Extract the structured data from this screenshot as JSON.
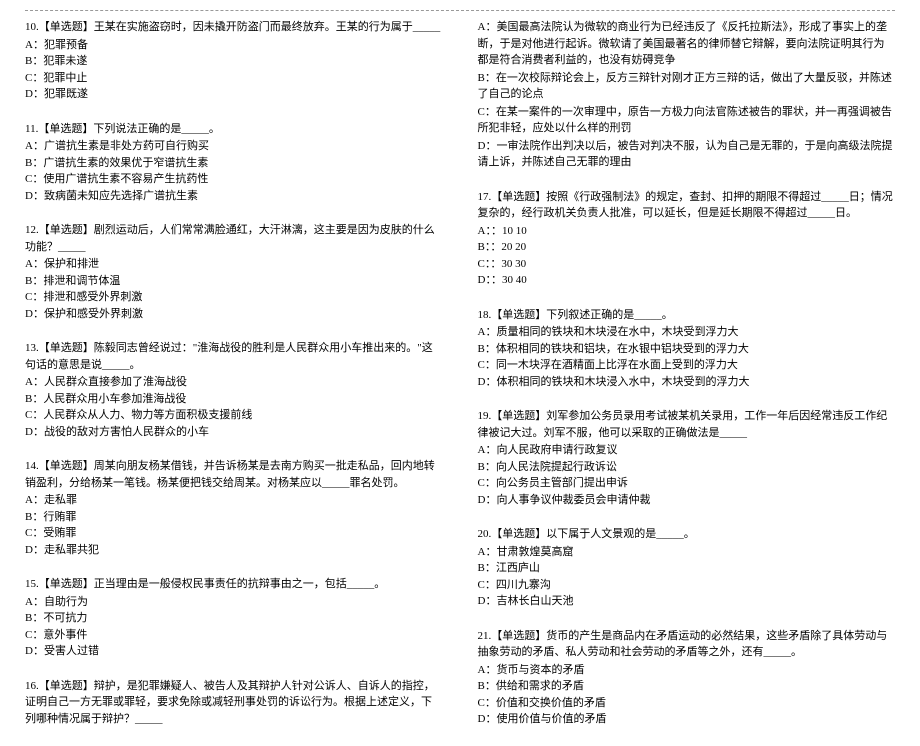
{
  "left": {
    "q10": {
      "title": "10.【单选题】王某在实施盗窃时，因未撬开防盗门而最终放弃。王某的行为属于_____",
      "a": "A：犯罪预备",
      "b": "B：犯罪未遂",
      "c": "C：犯罪中止",
      "d": "D：犯罪既遂"
    },
    "q11": {
      "title": "11.【单选题】下列说法正确的是_____。",
      "a": "A：广谱抗生素是非处方药可自行购买",
      "b": "B：广谱抗生素的效果优于窄谱抗生素",
      "c": "C：使用广谱抗生素不容易产生抗药性",
      "d": "D：致病菌未知应先选择广谱抗生素"
    },
    "q12": {
      "title": "12.【单选题】剧烈运动后，人们常常满脸通红，大汗淋漓，这主要是因为皮肤的什么功能？_____",
      "a": "A：保护和排泄",
      "b": "B：排泄和调节体温",
      "c": "C：排泄和感受外界刺激",
      "d": "D：保护和感受外界刺激"
    },
    "q13": {
      "title": "13.【单选题】陈毅同志曾经说过：\"淮海战役的胜利是人民群众用小车推出来的。\"这句话的意思是说_____。",
      "a": "A：人民群众直接参加了淮海战役",
      "b": "B：人民群众用小车参加淮海战役",
      "c": "C：人民群众从人力、物力等方面积极支援前线",
      "d": "D：战役的敌对方害怕人民群众的小车"
    },
    "q14": {
      "title": "14.【单选题】周某向朋友杨某借钱，并告诉杨某是去南方购买一批走私品，回内地转销盈利，分给杨某一笔钱。杨某便把钱交给周某。对杨某应以_____罪名处罚。",
      "a": "A：走私罪",
      "b": "B：行贿罪",
      "c": "C：受贿罪",
      "d": "D：走私罪共犯"
    },
    "q15": {
      "title": "15.【单选题】正当理由是一般侵权民事责任的抗辩事由之一，包括_____。",
      "a": "A：自助行为",
      "b": "B：不可抗力",
      "c": "C：意外事件",
      "d": "D：受害人过错"
    },
    "q16": {
      "title": "16.【单选题】辩护，是犯罪嫌疑人、被告人及其辩护人针对公诉人、自诉人的指控，证明自己一方无罪或罪轻，要求免除或减轻刑事处罚的诉讼行为。根据上述定义，下列哪种情况属于辩护？_____"
    }
  },
  "right": {
    "continuation": {
      "a": "A：美国最高法院认为微软的商业行为已经违反了《反托拉斯法》，形成了事实上的垄断，于是对他进行起诉。微软请了美国最著名的律师替它辩解，要向法院证明其行为都是符合消费者利益的，也没有妨碍竞争",
      "b": "B：在一次校际辩论会上，反方三辩针对刚才正方三辩的话，做出了大量反驳，并陈述了自己的论点",
      "c": "C：在某一案件的一次审理中，原告一方极力向法官陈述被告的罪状，并一再强调被告所犯非轻，应处以什么样的刑罚",
      "d": "D：一审法院作出判决以后，被告对判决不服，认为自己是无罪的，于是向高级法院提请上诉，并陈述自己无罪的理由"
    },
    "q17": {
      "title": "17.【单选题】按照《行政强制法》的规定，查封、扣押的期限不得超过_____日；情况复杂的，经行政机关负责人批准，可以延长，但是延长期限不得超过_____日。",
      "a": "A：：10 10",
      "b": "B：：20 20",
      "c": "C：：30 30",
      "d": "D：：30 40"
    },
    "q18": {
      "title": "18.【单选题】下列叙述正确的是_____。",
      "a": "A：质量相同的铁块和木块浸在水中，木块受到浮力大",
      "b": "B：体积相同的铁块和铝块，在水银中铝块受到的浮力大",
      "c": "C：同一木块浮在酒精面上比浮在水面上受到的浮力大",
      "d": "D：体积相同的铁块和木块浸入水中，木块受到的浮力大"
    },
    "q19": {
      "title": "19.【单选题】刘军参加公务员录用考试被某机关录用，工作一年后因经常违反工作纪律被记大过。刘军不服，他可以采取的正确做法是_____",
      "a": "A：向人民政府申请行政复议",
      "b": "B：向人民法院提起行政诉讼",
      "c": "C：向公务员主管部门提出申诉",
      "d": "D：向人事争议仲裁委员会申请仲裁"
    },
    "q20": {
      "title": "20.【单选题】以下属于人文景观的是_____。",
      "a": "A：甘肃敦煌莫高窟",
      "b": "B：江西庐山",
      "c": "C：四川九寨沟",
      "d": "D：吉林长白山天池"
    },
    "q21": {
      "title": "21.【单选题】货币的产生是商品内在矛盾运动的必然结果，这些矛盾除了具体劳动与抽象劳动的矛盾、私人劳动和社会劳动的矛盾等之外，还有_____。",
      "a": "A：货币与资本的矛盾",
      "b": "B：供给和需求的矛盾",
      "c": "C：价值和交换价值的矛盾",
      "d": "D：使用价值与价值的矛盾"
    }
  }
}
